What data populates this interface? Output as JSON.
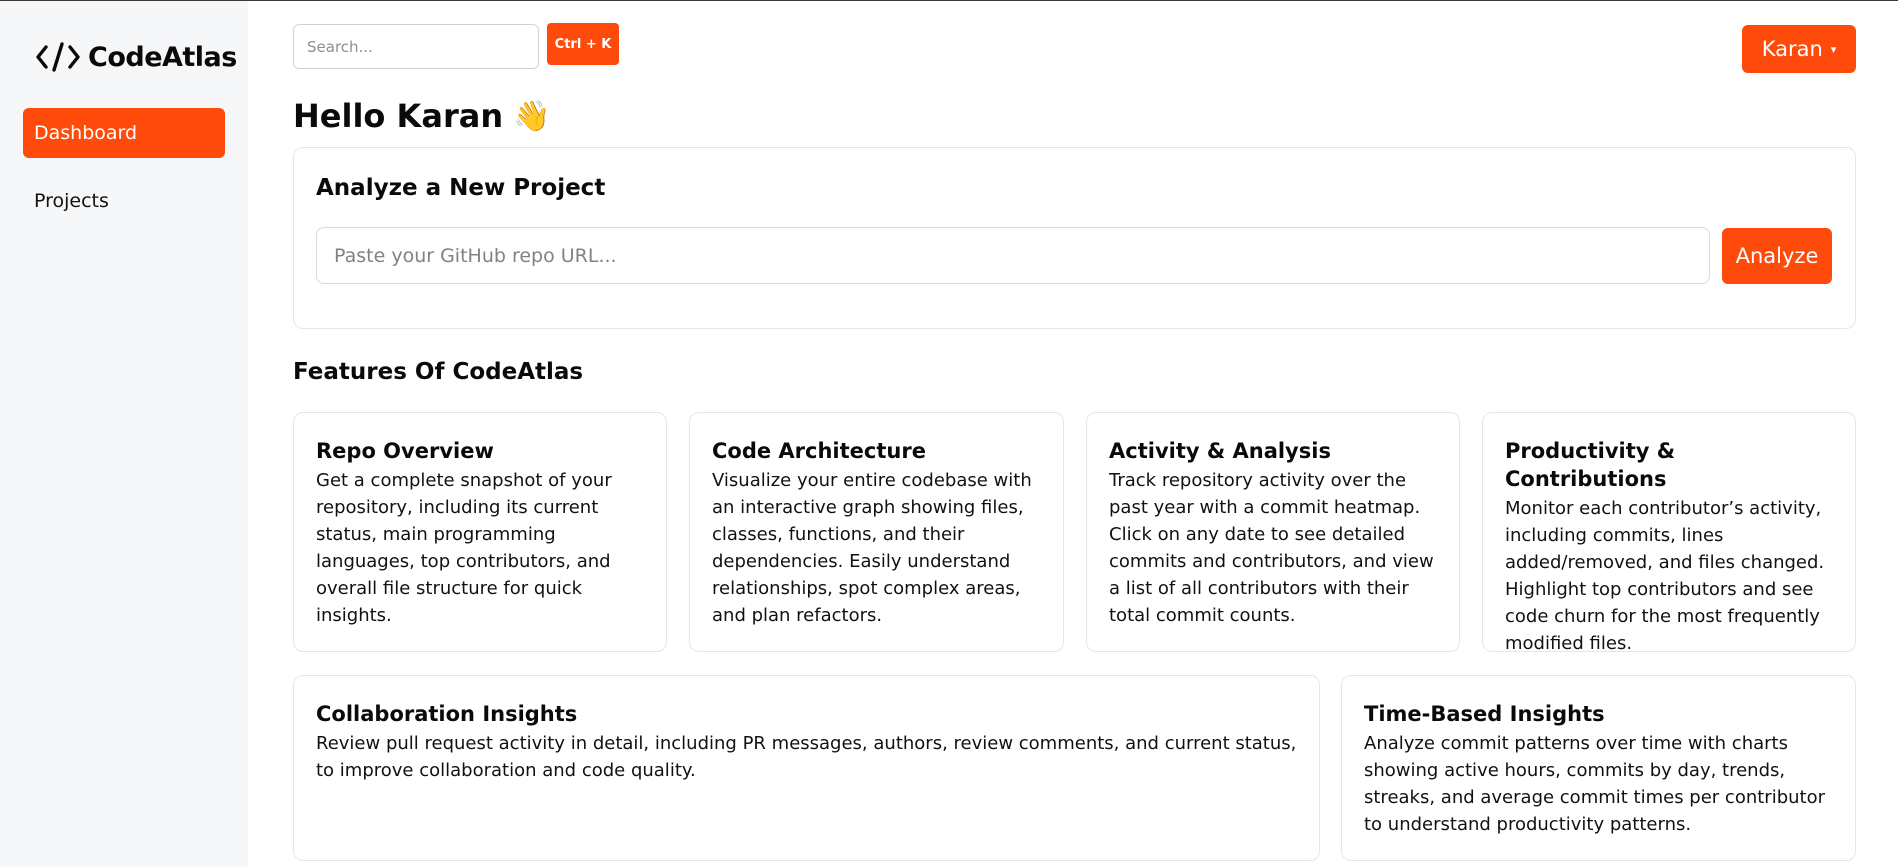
{
  "app": {
    "name": "CodeAtlas",
    "logo_icon": "code-brackets-icon"
  },
  "sidebar": {
    "items": [
      {
        "label": "Dashboard",
        "active": true
      },
      {
        "label": "Projects",
        "active": false
      }
    ]
  },
  "header": {
    "search_placeholder": "Search...",
    "shortcut_label": "Ctrl + K",
    "user_label": "Karan",
    "user_caret": "▾"
  },
  "greeting": {
    "text": "Hello Karan",
    "emoji": "👋"
  },
  "analyze": {
    "title": "Analyze a New Project",
    "placeholder": "Paste your GitHub repo URL...",
    "button_label": "Analyze"
  },
  "features": {
    "heading": "Features Of CodeAtlas",
    "cards": [
      {
        "title": "Repo Overview",
        "description": "Get a complete snapshot of your repository, including its current status, main programming languages, top contributors, and overall file structure for quick insights."
      },
      {
        "title": "Code Architecture",
        "description": "Visualize your entire codebase with an interactive graph showing files, classes, functions, and their dependencies. Easily understand relationships, spot complex areas, and plan refactors."
      },
      {
        "title": "Activity & Analysis",
        "description": "Track repository activity over the past year with a commit heatmap. Click on any date to see detailed commits and contributors, and view a list of all contributors with their total commit counts."
      },
      {
        "title": "Productivity & Contributions",
        "description": "Monitor each contributor’s activity, including commits, lines added/removed, and files changed. Highlight top contributors and see code churn for the most frequently modified files."
      },
      {
        "title": "Collaboration Insights",
        "description": "Review pull request activity in detail, including PR messages, authors, review comments, and current status, to improve collaboration and code quality."
      },
      {
        "title": "Time-Based Insights",
        "description": "Analyze commit patterns over time with charts showing active hours, commits by day, trends, streaks, and average commit times per contributor to understand productivity patterns."
      }
    ]
  },
  "colors": {
    "accent": "#fe4a0a",
    "sidebar_bg": "#f6f7f9",
    "card_border": "#e4e6ea"
  }
}
